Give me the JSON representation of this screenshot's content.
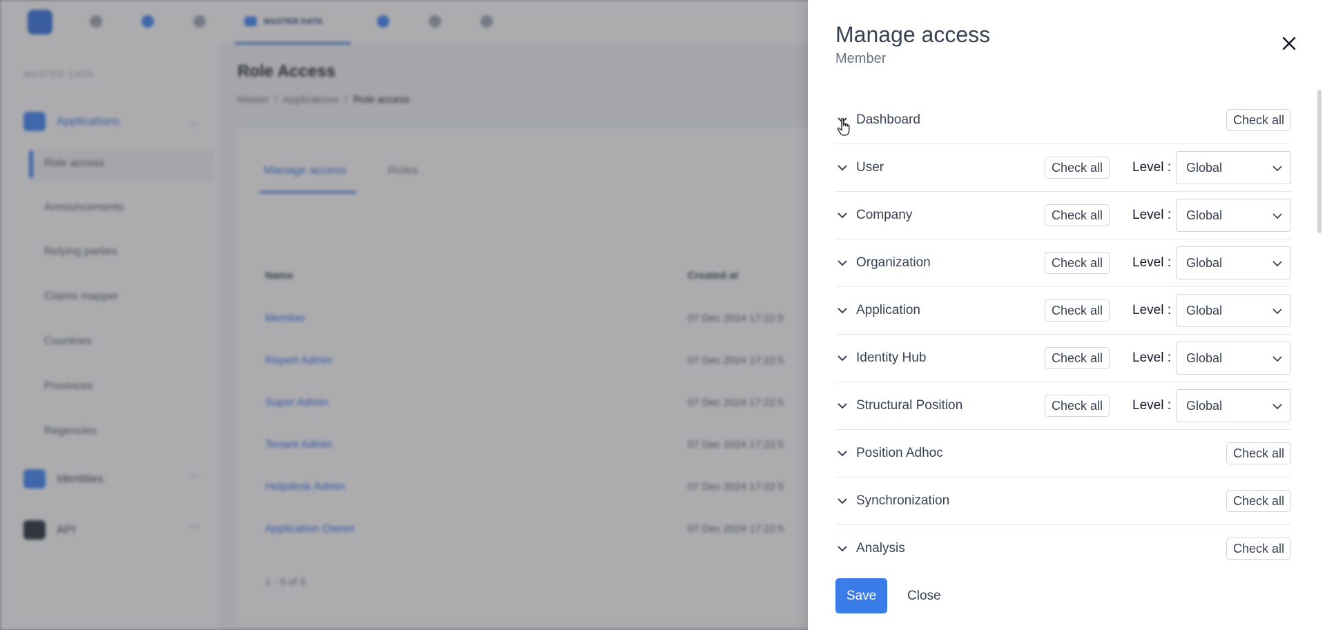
{
  "background": {
    "top_nav_active": "MASTER DATA",
    "sidebar": {
      "heading": "MASTER DATA",
      "groups": [
        {
          "label": "Applications"
        },
        {
          "label": "Identities"
        },
        {
          "label": "API"
        }
      ],
      "sub_items": [
        "Role access",
        "Announcements",
        "Relying parties",
        "Claims mapper",
        "Countries",
        "Provinces",
        "Regencies"
      ]
    },
    "page_title": "Role Access",
    "breadcrumb": [
      "Master",
      "Applications",
      "Role access"
    ],
    "tabs": [
      "Manage access",
      "Roles"
    ],
    "table": {
      "headers": [
        "Name",
        "Created at"
      ],
      "rows": [
        {
          "name": "Member",
          "created": "07 Dec 2024 17:22:5"
        },
        {
          "name": "Report Admin",
          "created": "07 Dec 2024 17:22:5"
        },
        {
          "name": "Super Admin",
          "created": "07 Dec 2024 17:22:5"
        },
        {
          "name": "Tenant Admin",
          "created": "07 Dec 2024 17:22:5"
        },
        {
          "name": "Helpdesk Admin",
          "created": "07 Dec 2024 17:22:5"
        },
        {
          "name": "Application Owner",
          "created": "07 Dec 2024 17:22:5"
        }
      ],
      "footer": "1 - 6 of 6"
    }
  },
  "drawer": {
    "title": "Manage access",
    "subtitle": "Member",
    "level_label": "Level :",
    "check_all_label": "Check all",
    "sections": [
      {
        "label": "Dashboard",
        "has_level": false
      },
      {
        "label": "User",
        "has_level": true,
        "level": "Global"
      },
      {
        "label": "Company",
        "has_level": true,
        "level": "Global"
      },
      {
        "label": "Organization",
        "has_level": true,
        "level": "Global"
      },
      {
        "label": "Application",
        "has_level": true,
        "level": "Global"
      },
      {
        "label": "Identity Hub",
        "has_level": true,
        "level": "Global"
      },
      {
        "label": "Structural Position",
        "has_level": true,
        "level": "Global"
      },
      {
        "label": "Position Adhoc",
        "has_level": false
      },
      {
        "label": "Synchronization",
        "has_level": false
      },
      {
        "label": "Analysis",
        "has_level": false
      }
    ],
    "save_label": "Save",
    "close_label": "Close"
  },
  "icons": {
    "close": "close-icon",
    "expand": "chevron-down-icon",
    "select": "chevron-down-icon",
    "cursor": "hand-pointer-icon"
  },
  "colors": {
    "primary": "#3b7de8",
    "text": "#374151",
    "border": "#d1d5db"
  }
}
